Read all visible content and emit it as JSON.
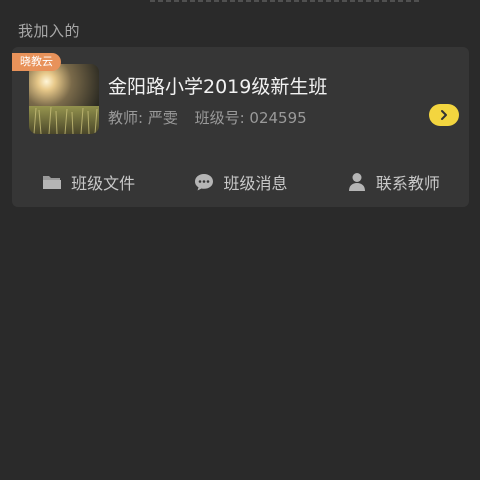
{
  "section": {
    "title": "我加入的"
  },
  "class_card": {
    "badge": "晓教云",
    "title": "金阳路小学2019级新生班",
    "teacher_label": "教师: 严雯",
    "class_id_label": "班级号: 024595",
    "actions": [
      {
        "label": "班级文件",
        "icon": "folder-icon"
      },
      {
        "label": "班级消息",
        "icon": "chat-bubble-icon"
      },
      {
        "label": "联系教师",
        "icon": "person-icon"
      }
    ]
  },
  "colors": {
    "background": "#2a2a2a",
    "card": "#363636",
    "badge": "#e8925a",
    "enter_button": "#f3d53f"
  }
}
